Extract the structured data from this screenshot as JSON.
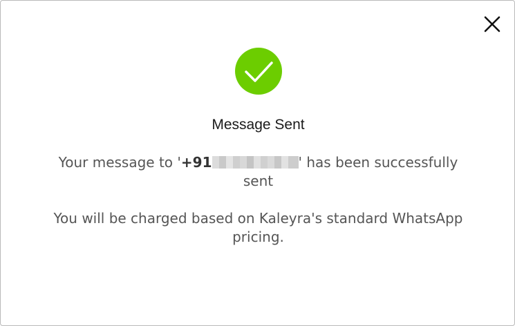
{
  "dialog": {
    "close_label": "close",
    "icon": "check-circle-icon",
    "accent_color": "#6ccd00",
    "title": "Message Sent",
    "message_prefix": "Your message to '",
    "phone_visible": "+91",
    "message_suffix": "' has been successfully sent",
    "charge_note": "You will be charged based on Kaleyra's standard WhatsApp pricing."
  }
}
